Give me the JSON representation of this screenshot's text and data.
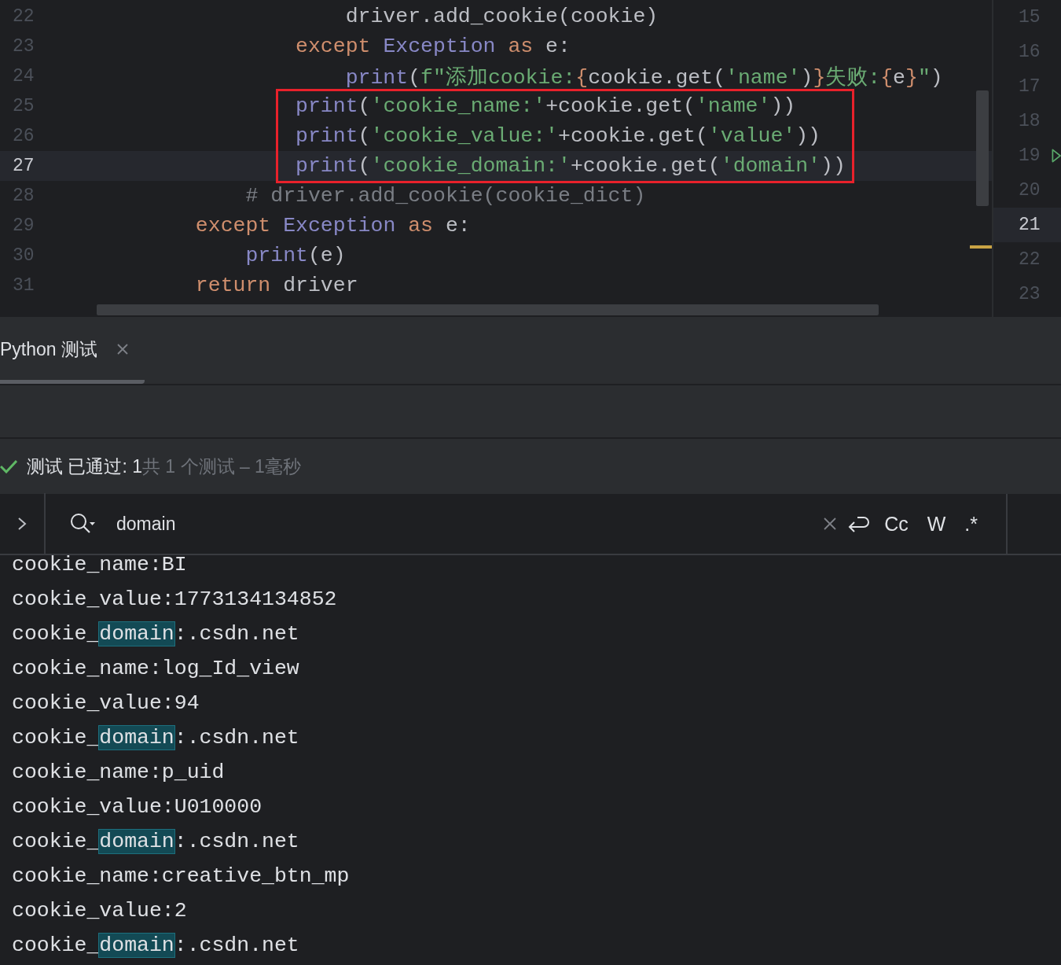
{
  "editor": {
    "lines": [
      {
        "number": "22",
        "current": false,
        "boxed": false,
        "tokens": [
          {
            "kind": "plain",
            "text": "                        driver.add_cookie(cookie)"
          }
        ]
      },
      {
        "number": "23",
        "current": false,
        "boxed": false,
        "tokens": [
          {
            "kind": "keyword",
            "text": "                    except "
          },
          {
            "kind": "builtin",
            "text": "Exception "
          },
          {
            "kind": "keyword",
            "text": "as"
          },
          {
            "kind": "plain",
            "text": " e:"
          }
        ]
      },
      {
        "number": "24",
        "current": false,
        "boxed": false,
        "tokens": [
          {
            "kind": "builtin",
            "text": "                        print"
          },
          {
            "kind": "plain",
            "text": "("
          },
          {
            "kind": "string",
            "text": "f\"添加cookie:"
          },
          {
            "kind": "brace",
            "text": "{"
          },
          {
            "kind": "plain",
            "text": "cookie.get("
          },
          {
            "kind": "string",
            "text": "'name'"
          },
          {
            "kind": "plain",
            "text": ")"
          },
          {
            "kind": "brace",
            "text": "}"
          },
          {
            "kind": "string",
            "text": "失败:"
          },
          {
            "kind": "brace",
            "text": "{"
          },
          {
            "kind": "plain",
            "text": "e"
          },
          {
            "kind": "brace",
            "text": "}"
          },
          {
            "kind": "string",
            "text": "\""
          },
          {
            "kind": "plain",
            "text": ")"
          }
        ]
      },
      {
        "number": "25",
        "current": false,
        "boxed": true,
        "tokens": [
          {
            "kind": "builtin",
            "text": "                    print"
          },
          {
            "kind": "plain",
            "text": "("
          },
          {
            "kind": "string",
            "text": "'cookie_name:'"
          },
          {
            "kind": "plain",
            "text": "+cookie.get("
          },
          {
            "kind": "string",
            "text": "'name'"
          },
          {
            "kind": "plain",
            "text": "))"
          }
        ]
      },
      {
        "number": "26",
        "current": false,
        "boxed": true,
        "tokens": [
          {
            "kind": "builtin",
            "text": "                    print"
          },
          {
            "kind": "plain",
            "text": "("
          },
          {
            "kind": "string",
            "text": "'cookie_value:'"
          },
          {
            "kind": "plain",
            "text": "+cookie.get("
          },
          {
            "kind": "string",
            "text": "'value'"
          },
          {
            "kind": "plain",
            "text": "))"
          }
        ]
      },
      {
        "number": "27",
        "current": true,
        "boxed": true,
        "tokens": [
          {
            "kind": "builtin",
            "text": "                    print"
          },
          {
            "kind": "plain",
            "text": "("
          },
          {
            "kind": "string",
            "text": "'cookie_domain:'"
          },
          {
            "kind": "plain",
            "text": "+cookie.get("
          },
          {
            "kind": "string",
            "text": "'domain'"
          },
          {
            "kind": "plain",
            "text": "))"
          }
        ]
      },
      {
        "number": "28",
        "current": false,
        "boxed": false,
        "tokens": [
          {
            "kind": "comment",
            "text": "                # driver.add_cookie(cookie_dict)"
          }
        ]
      },
      {
        "number": "29",
        "current": false,
        "boxed": false,
        "tokens": [
          {
            "kind": "keyword",
            "text": "            except "
          },
          {
            "kind": "builtin",
            "text": "Exception "
          },
          {
            "kind": "keyword",
            "text": "as"
          },
          {
            "kind": "plain",
            "text": " e:"
          }
        ]
      },
      {
        "number": "30",
        "current": false,
        "boxed": false,
        "tokens": [
          {
            "kind": "builtin",
            "text": "                print"
          },
          {
            "kind": "plain",
            "text": "(e)"
          }
        ]
      },
      {
        "number": "31",
        "current": false,
        "boxed": false,
        "tokens": [
          {
            "kind": "keyword",
            "text": "            return"
          },
          {
            "kind": "plain",
            "text": " driver"
          }
        ]
      }
    ]
  },
  "side_gutter": {
    "lines": [
      {
        "number": "15",
        "current": false,
        "run": false
      },
      {
        "number": "16",
        "current": false,
        "run": false
      },
      {
        "number": "17",
        "current": false,
        "run": false
      },
      {
        "number": "18",
        "current": false,
        "run": false
      },
      {
        "number": "19",
        "current": false,
        "run": true
      },
      {
        "number": "20",
        "current": false,
        "run": false
      },
      {
        "number": "21",
        "current": true,
        "run": false
      },
      {
        "number": "22",
        "current": false,
        "run": false
      },
      {
        "number": "23",
        "current": false,
        "run": false
      }
    ]
  },
  "run_tab": {
    "label": "Python 测试",
    "selected": true
  },
  "status": {
    "passed": "测试 已通过: 1",
    "summary": "共 1 个测试 – 1毫秒"
  },
  "search": {
    "value": "domain",
    "options": [
      "Cc",
      "W",
      ".*"
    ]
  },
  "output": [
    [
      {
        "text": "cookie_name:BI",
        "match": false
      }
    ],
    [
      {
        "text": "cookie_value:1773134134852",
        "match": false
      }
    ],
    [
      {
        "text": "cookie_",
        "match": false
      },
      {
        "text": "domain",
        "match": true
      },
      {
        "text": ":.csdn.net",
        "match": false
      }
    ],
    [
      {
        "text": "cookie_name:log_Id_view",
        "match": false
      }
    ],
    [
      {
        "text": "cookie_value:94",
        "match": false
      }
    ],
    [
      {
        "text": "cookie_",
        "match": false
      },
      {
        "text": "domain",
        "match": true
      },
      {
        "text": ":.csdn.net",
        "match": false
      }
    ],
    [
      {
        "text": "cookie_name:p_uid",
        "match": false
      }
    ],
    [
      {
        "text": "cookie_value:U010000",
        "match": false
      }
    ],
    [
      {
        "text": "cookie_",
        "match": false
      },
      {
        "text": "domain",
        "match": true
      },
      {
        "text": ":.csdn.net",
        "match": false
      }
    ],
    [
      {
        "text": "cookie_name:creative_btn_mp",
        "match": false
      }
    ],
    [
      {
        "text": "cookie_value:2",
        "match": false
      }
    ],
    [
      {
        "text": "cookie_",
        "match": false
      },
      {
        "text": "domain",
        "match": true
      },
      {
        "text": ":.csdn.net",
        "match": false
      }
    ]
  ]
}
